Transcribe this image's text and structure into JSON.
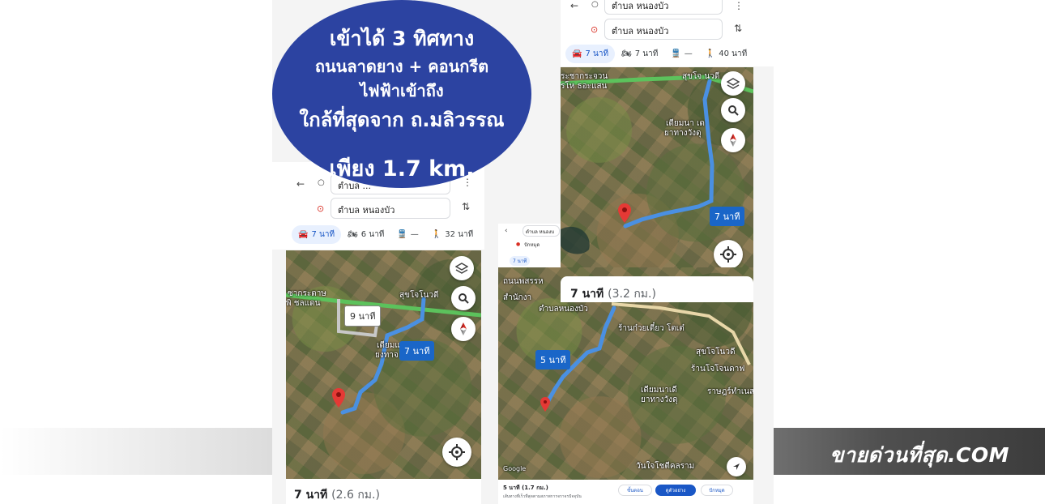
{
  "banner": {
    "brand": "ขายด่วนที่สุด.COM"
  },
  "headline": {
    "line1": "เข้าได้ 3 ทิศทาง",
    "line2": "ถนนลาดยาง + คอนกรีต",
    "line3": "ไฟฟ้าเข้าถึง",
    "line4": "ใกล้ที่สุดจาก ถ.มลิวรรณ",
    "line5": "เพียง 1.7 km."
  },
  "panel_left": {
    "origin": "ตำบล ...",
    "destination": "ตำบล หนองบัว",
    "modes": [
      {
        "icon": "car-icon",
        "label": "7 นาที",
        "active": true
      },
      {
        "icon": "motorbike-icon",
        "label": "6 นาที",
        "active": false
      },
      {
        "icon": "transit-icon",
        "label": "—",
        "active": false
      },
      {
        "icon": "walk-icon",
        "label": "32 นาที",
        "active": false
      }
    ],
    "route_labels": {
      "main": "7 นาที",
      "alt": "9 นาที"
    },
    "map_texts": {
      "t1": "ซากระดาษ",
      "t2": "พิ ชลแดน",
      "t3": "สุขโจโนวดี",
      "t4": "เดียมแ",
      "t5": "ยงทาจ"
    },
    "summary_time": "7 นาที",
    "summary_distance": "(2.6 กม.)"
  },
  "panel_right_top": {
    "origin": "ตำบล หนองบัว",
    "destination": "ตำบล หนองบัว",
    "modes": [
      {
        "icon": "car-icon",
        "label": "7 นาที",
        "active": true
      },
      {
        "icon": "motorbike-icon",
        "label": "7 นาที",
        "active": false
      },
      {
        "icon": "transit-icon",
        "label": "—",
        "active": false
      },
      {
        "icon": "walk-icon",
        "label": "40 นาที",
        "active": false
      }
    ],
    "route_label": "7 นาที",
    "map_texts": {
      "t1": "ระชากระจวน",
      "t2": "รโห ธอะแสน",
      "t3": "สุขโจ นวดี",
      "t4": "เดียมนา เด",
      "t5": "ยาทางวังดุ"
    }
  },
  "panel_right_bottom": {
    "mini_origin": "ตำบล หนองบ",
    "mini_destination": "ปักหมุด",
    "mini_mode": "7 นาที",
    "summary_time": "7 นาที",
    "summary_distance": "(3.2 กม.)",
    "route_label": "5 นาที",
    "map_texts": {
      "t1": "ถนนพสรรห",
      "t2": "สำนักงา",
      "t3": "ตำบลหนองบัว",
      "t4": "ร้านก๋วยเตี๋ยว โตเต๋",
      "t5": "สุขโจโนวดี",
      "t6": "ร้านโจโจนดาฟ",
      "t7": "เดียมนาเดี",
      "t8": "ยาทางวังดุ",
      "t9": "ราษฎร์ทำเนส",
      "t10": "วันใจโชตีคลราม",
      "google": "Google"
    },
    "bottom_time": "5 นาที (1.7 กม.)",
    "bottom_note": "เส้นทางที่เร็วที่สุดตามสภาพการจราจรปัจจุบัน",
    "buttons": {
      "steps": "ขั้นตอน",
      "start": "ดูตัวอย่าง",
      "pin": "ปักหมุด"
    }
  },
  "colors": {
    "oval": "#2c43a1",
    "route": "#4a90e2",
    "route_label": "#1a66c8",
    "pin": "#e53935"
  }
}
